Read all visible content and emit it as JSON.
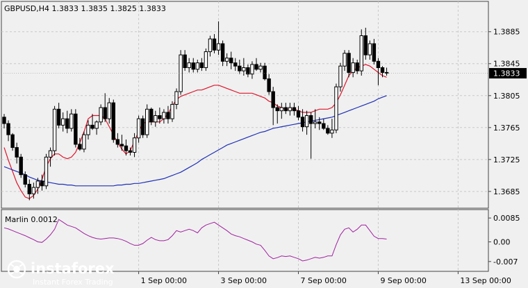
{
  "symbol_header": "GBPUSD,H4  1.3833 1.3835 1.3825 1.3833",
  "indicator_label": "Marlin 0.0012",
  "watermark": {
    "brand": "instaforex",
    "tagline": "Instant Forex Trading"
  },
  "colors": {
    "background": "#f0f0f0",
    "grid": "#c8c8c8",
    "red_line": "#e0142a",
    "blue_line": "#1d2fb8",
    "oscillator": "#a020a0",
    "candle": "#000000",
    "current_price_bg": "#000000",
    "current_price_fg": "#ffffff"
  },
  "chart_data": [
    {
      "type": "candlestick",
      "title": "GBPUSD,H4",
      "ylim": [
        1.3664,
        1.3923
      ],
      "y_ticks": [
        "1.3885",
        "1.3845",
        "1.3805",
        "1.3765",
        "1.3725",
        "1.3685"
      ],
      "current_price": "1.3833",
      "x_ticks": [
        "1 Sep 00:00",
        "3 Sep 00:00",
        "7 Sep 00:00",
        "9 Sep 00:00",
        "13 Sep 00:00"
      ],
      "x_tick_bar_index": [
        32,
        51,
        70,
        89,
        108
      ],
      "candles": [
        [
          1.3778,
          1.3782,
          1.3764,
          1.377
        ],
        [
          1.377,
          1.3774,
          1.3748,
          1.3756
        ],
        [
          1.3756,
          1.3758,
          1.3736,
          1.374
        ],
        [
          1.374,
          1.3746,
          1.372,
          1.3728
        ],
        [
          1.3728,
          1.3732,
          1.3702,
          1.3706
        ],
        [
          1.3706,
          1.371,
          1.369,
          1.3694
        ],
        [
          1.3694,
          1.37,
          1.3674,
          1.3682
        ],
        [
          1.3682,
          1.3696,
          1.3676,
          1.369
        ],
        [
          1.369,
          1.3702,
          1.3682,
          1.3698
        ],
        [
          1.3698,
          1.3706,
          1.3686,
          1.3692
        ],
        [
          1.3692,
          1.3732,
          1.3688,
          1.3728
        ],
        [
          1.3728,
          1.374,
          1.3716,
          1.3736
        ],
        [
          1.3736,
          1.3792,
          1.373,
          1.3788
        ],
        [
          1.3788,
          1.3796,
          1.3764,
          1.3768
        ],
        [
          1.3768,
          1.3784,
          1.376,
          1.3776
        ],
        [
          1.3776,
          1.3786,
          1.3758,
          1.3764
        ],
        [
          1.3764,
          1.3788,
          1.376,
          1.3782
        ],
        [
          1.3782,
          1.3788,
          1.374,
          1.3744
        ],
        [
          1.3744,
          1.3752,
          1.3736,
          1.3738
        ],
        [
          1.3738,
          1.376,
          1.3734,
          1.3756
        ],
        [
          1.3756,
          1.3774,
          1.375,
          1.3768
        ],
        [
          1.3768,
          1.3782,
          1.3762,
          1.3764
        ],
        [
          1.3764,
          1.3774,
          1.3756,
          1.3772
        ],
        [
          1.3772,
          1.3794,
          1.3768,
          1.379
        ],
        [
          1.379,
          1.3808,
          1.3772,
          1.3776
        ],
        [
          1.3776,
          1.3802,
          1.377,
          1.3796
        ],
        [
          1.3796,
          1.38,
          1.3746,
          1.375
        ],
        [
          1.375,
          1.3758,
          1.374,
          1.3744
        ],
        [
          1.3744,
          1.3756,
          1.3736,
          1.3742
        ],
        [
          1.3742,
          1.375,
          1.373,
          1.3736
        ],
        [
          1.3736,
          1.374,
          1.373,
          1.3734
        ],
        [
          1.3734,
          1.3758,
          1.3728,
          1.3752
        ],
        [
          1.3752,
          1.378,
          1.3746,
          1.3776
        ],
        [
          1.3776,
          1.378,
          1.3752,
          1.3756
        ],
        [
          1.3756,
          1.3794,
          1.3752,
          1.3788
        ],
        [
          1.3788,
          1.379,
          1.3768,
          1.3772
        ],
        [
          1.3772,
          1.3786,
          1.3766,
          1.378
        ],
        [
          1.378,
          1.379,
          1.377,
          1.3776
        ],
        [
          1.3776,
          1.3788,
          1.377,
          1.3784
        ],
        [
          1.3784,
          1.3792,
          1.377,
          1.3776
        ],
        [
          1.3776,
          1.3798,
          1.3772,
          1.3794
        ],
        [
          1.3794,
          1.3814,
          1.3788,
          1.381
        ],
        [
          1.381,
          1.3862,
          1.3806,
          1.3856
        ],
        [
          1.3856,
          1.3862,
          1.3836,
          1.384
        ],
        [
          1.384,
          1.3852,
          1.3834,
          1.3846
        ],
        [
          1.3846,
          1.3852,
          1.3834,
          1.3838
        ],
        [
          1.3838,
          1.385,
          1.3834,
          1.3846
        ],
        [
          1.3846,
          1.3852,
          1.3836,
          1.384
        ],
        [
          1.384,
          1.3864,
          1.3836,
          1.386
        ],
        [
          1.386,
          1.388,
          1.3854,
          1.3876
        ],
        [
          1.3876,
          1.3882,
          1.3858,
          1.3862
        ],
        [
          1.3862,
          1.3898,
          1.3856,
          1.387
        ],
        [
          1.387,
          1.3874,
          1.3842,
          1.3848
        ],
        [
          1.3848,
          1.3858,
          1.3842,
          1.3852
        ],
        [
          1.3852,
          1.386,
          1.3838,
          1.3846
        ],
        [
          1.3846,
          1.3852,
          1.3836,
          1.3842
        ],
        [
          1.3842,
          1.385,
          1.3832,
          1.3836
        ],
        [
          1.3836,
          1.3852,
          1.383,
          1.384
        ],
        [
          1.384,
          1.3844,
          1.3828,
          1.3832
        ],
        [
          1.3832,
          1.3848,
          1.3826,
          1.3844
        ],
        [
          1.3844,
          1.3852,
          1.3836,
          1.3838
        ],
        [
          1.3838,
          1.3846,
          1.3834,
          1.3842
        ],
        [
          1.3842,
          1.3846,
          1.3824,
          1.3826
        ],
        [
          1.3826,
          1.3832,
          1.3806,
          1.381
        ],
        [
          1.381,
          1.3816,
          1.3768,
          1.379
        ],
        [
          1.379,
          1.3794,
          1.377,
          1.3786
        ],
        [
          1.3786,
          1.3796,
          1.3776,
          1.379
        ],
        [
          1.379,
          1.3796,
          1.3782,
          1.3786
        ],
        [
          1.3786,
          1.3796,
          1.378,
          1.379
        ],
        [
          1.379,
          1.3796,
          1.378,
          1.3786
        ],
        [
          1.3786,
          1.3792,
          1.3774,
          1.3778
        ],
        [
          1.3778,
          1.3788,
          1.376,
          1.3766
        ],
        [
          1.3766,
          1.3786,
          1.3756,
          1.378
        ],
        [
          1.378,
          1.3784,
          1.3726,
          1.377
        ],
        [
          1.377,
          1.3788,
          1.3764,
          1.3772
        ],
        [
          1.3772,
          1.3778,
          1.3762,
          1.377
        ],
        [
          1.377,
          1.3776,
          1.3762,
          1.3764
        ],
        [
          1.3764,
          1.3768,
          1.3756,
          1.3758
        ],
        [
          1.3758,
          1.3776,
          1.3752,
          1.3762
        ],
        [
          1.3762,
          1.382,
          1.3758,
          1.3816
        ],
        [
          1.3816,
          1.3846,
          1.381,
          1.3842
        ],
        [
          1.3842,
          1.3862,
          1.3836,
          1.3858
        ],
        [
          1.3858,
          1.3862,
          1.3828,
          1.3834
        ],
        [
          1.3834,
          1.3852,
          1.3828,
          1.3846
        ],
        [
          1.3846,
          1.385,
          1.3832,
          1.3836
        ],
        [
          1.3836,
          1.3888,
          1.383,
          1.388
        ],
        [
          1.388,
          1.389,
          1.385,
          1.3856
        ],
        [
          1.3856,
          1.3874,
          1.385,
          1.387
        ],
        [
          1.387,
          1.3876,
          1.3844,
          1.3848
        ],
        [
          1.3848,
          1.3852,
          1.3818,
          1.384
        ],
        [
          1.384,
          1.3842,
          1.3828,
          1.3834
        ],
        [
          1.3834,
          1.384,
          1.383,
          1.3833
        ]
      ],
      "series": [
        {
          "name": "",
          "color": "#e0142a",
          "values": [
            1.374,
            1.3724,
            1.371,
            1.3696,
            1.3686,
            1.3678,
            1.3676,
            1.368,
            1.3688,
            1.37,
            1.3716,
            1.3726,
            1.3732,
            1.3732,
            1.3728,
            1.3726,
            1.3728,
            1.3734,
            1.3746,
            1.376,
            1.3776,
            1.378,
            1.378,
            1.378,
            1.3776,
            1.3766,
            1.3756,
            1.3746,
            1.3738,
            1.3732,
            1.3736,
            1.3748,
            1.376,
            1.377,
            1.3772,
            1.3772,
            1.3772,
            1.3772,
            1.3776,
            1.3782,
            1.3792,
            1.38,
            1.3804,
            1.3806,
            1.3808,
            1.381,
            1.3812,
            1.3812,
            1.3814,
            1.3816,
            1.3818,
            1.3818,
            1.3816,
            1.3814,
            1.3812,
            1.381,
            1.3808,
            1.3808,
            1.3808,
            1.3808,
            1.3806,
            1.3804,
            1.3802,
            1.3798,
            1.3796,
            1.3792,
            1.379,
            1.3788,
            1.3788,
            1.3788,
            1.3786,
            1.3784,
            1.3784,
            1.3784,
            1.3786,
            1.3788,
            1.3788,
            1.3788,
            1.379,
            1.3796,
            1.3806,
            1.3818,
            1.383,
            1.3836,
            1.384,
            1.3842,
            1.3844,
            1.3842,
            1.3838,
            1.3834,
            1.383,
            1.3828
          ]
        },
        {
          "name": "",
          "color": "#1d2fb8",
          "values": [
            1.3716,
            1.3714,
            1.3712,
            1.371,
            1.3708,
            1.3706,
            1.3703,
            1.3701,
            1.3699,
            1.3698,
            1.3697,
            1.3696,
            1.3695,
            1.3694,
            1.3694,
            1.3693,
            1.3693,
            1.3692,
            1.3692,
            1.3692,
            1.3692,
            1.3692,
            1.3692,
            1.3692,
            1.3692,
            1.3692,
            1.3692,
            1.3693,
            1.3693,
            1.3694,
            1.3694,
            1.3695,
            1.3695,
            1.3696,
            1.3697,
            1.3698,
            1.3699,
            1.37,
            1.3701,
            1.3703,
            1.3705,
            1.3707,
            1.3709,
            1.3712,
            1.3715,
            1.3718,
            1.3721,
            1.3725,
            1.3728,
            1.3731,
            1.3734,
            1.3737,
            1.374,
            1.3743,
            1.3745,
            1.3747,
            1.3749,
            1.3751,
            1.3753,
            1.3755,
            1.3757,
            1.3759,
            1.376,
            1.3762,
            1.3764,
            1.3765,
            1.3766,
            1.3767,
            1.3768,
            1.3769,
            1.377,
            1.3771,
            1.3772,
            1.3773,
            1.3774,
            1.3775,
            1.3776,
            1.3777,
            1.3778,
            1.378,
            1.3782,
            1.3784,
            1.3786,
            1.3788,
            1.379,
            1.3792,
            1.3794,
            1.3796,
            1.3798,
            1.3801,
            1.3803,
            1.3805
          ]
        }
      ]
    },
    {
      "type": "line",
      "title": "Marlin 0.0012",
      "ylim": [
        -0.0105,
        0.0115
      ],
      "y_ticks": [
        "0.0085",
        "0.00",
        "-0.007"
      ],
      "series": [
        {
          "name": "",
          "color": "#a020a0",
          "values": [
            0.005,
            0.0046,
            0.004,
            0.0034,
            0.0028,
            0.0022,
            0.0015,
            0.0008,
            0.0,
            -0.0002,
            0.001,
            0.0025,
            0.0045,
            0.008,
            0.007,
            0.006,
            0.0055,
            0.005,
            0.004,
            0.003,
            0.0022,
            0.0016,
            0.0012,
            0.001,
            0.0012,
            0.0014,
            0.0014,
            0.0012,
            0.0008,
            0.0002,
            -0.0006,
            -0.0012,
            -0.0012,
            -0.0006,
            0.0006,
            0.0016,
            0.0008,
            0.0004,
            0.0004,
            0.0008,
            0.0022,
            0.004,
            0.0035,
            0.004,
            0.0045,
            0.004,
            0.0032,
            0.005,
            0.006,
            0.0065,
            0.007,
            0.006,
            0.005,
            0.004,
            0.0028,
            0.0022,
            0.0018,
            0.0012,
            0.0006,
            0.0,
            -0.0008,
            -0.0012,
            -0.003,
            -0.005,
            -0.006,
            -0.0056,
            -0.005,
            -0.0052,
            -0.005,
            -0.0055,
            -0.006,
            -0.0068,
            -0.0065,
            -0.006,
            -0.0055,
            -0.0058,
            -0.0055,
            -0.005,
            -0.005,
            -0.001,
            0.0025,
            0.0045,
            0.005,
            0.0035,
            0.0045,
            0.006,
            0.006,
            0.004,
            0.002,
            0.0012,
            0.0012,
            0.001
          ]
        }
      ]
    }
  ]
}
